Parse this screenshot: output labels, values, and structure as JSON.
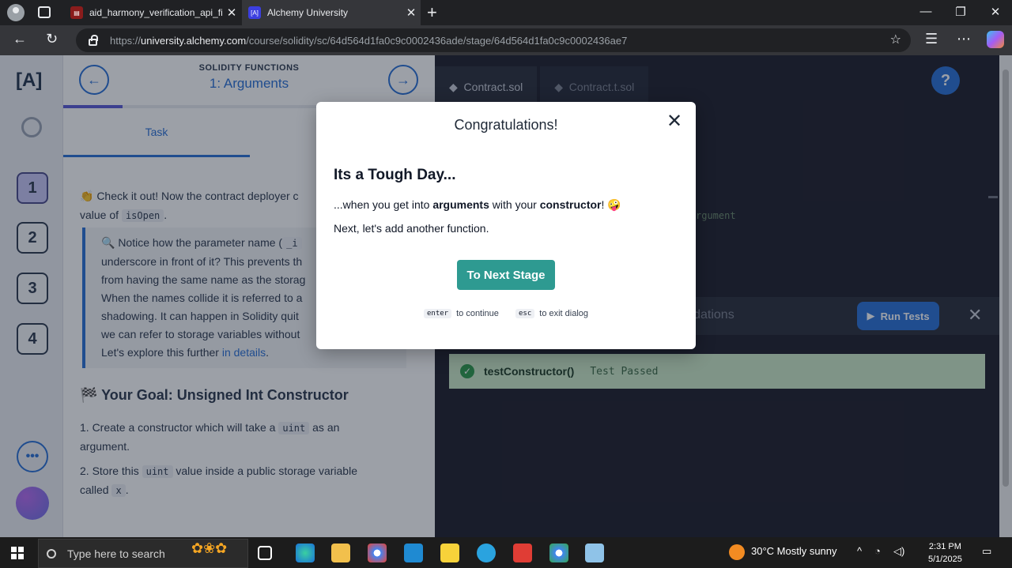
{
  "browser": {
    "tabs": [
      {
        "title": "aid_harmony_verification_api_field",
        "active": false
      },
      {
        "title": "Alchemy University",
        "active": true
      }
    ],
    "url_prefix": "https://",
    "url_host": "university.alchemy.com",
    "url_path": "/course/solidity/sc/64d564d1fa0c9c0002436ade/stage/64d564d1fa0c9c0002436ae7"
  },
  "rail": {
    "logo": "[A]",
    "stages": [
      "1",
      "2",
      "3",
      "4"
    ],
    "more": "•••"
  },
  "lesson": {
    "section": "SOLIDITY FUNCTIONS",
    "stage": "1: Arguments",
    "task_tab": "Task",
    "para1_pre": "👏 Check it out! Now the contract deployer c",
    "para1_line2_pre": "value of ",
    "para1_code": "isOpen",
    "para1_line2_post": ".",
    "note_lines": [
      "🔍 Notice how the parameter name (",
      "underscore in front of it? This prevents th",
      "from having the same name as the storag",
      "When the names collide it is referred to a",
      "shadowing. It can happen in Solidity quit",
      "we can refer to storage variables without",
      "Let's explore this further "
    ],
    "note_code": "_i",
    "note_link": "in details",
    "goal_title": "🏁 Your Goal: Unsigned Int Constructor",
    "goal_items": [
      {
        "pre": "1. Create a constructor which will take a ",
        "code": "uint",
        "post": " as an argument."
      },
      {
        "pre": "2. Store this ",
        "code": "uint",
        "post": " value inside a public storage variable called "
      },
      {
        "code2": "x",
        "post2": "."
      }
    ]
  },
  "editor": {
    "tabs": [
      "Contract.sol",
      "Contract.t.sol"
    ],
    "help": "?",
    "code_snippet": "rgument",
    "results_label": "lidations",
    "run_tests": "Run Tests",
    "test_name": "testConstructor()",
    "test_status": "Test Passed"
  },
  "modal": {
    "title": "Congratulations!",
    "heading": "Its a Tough Day...",
    "body_pre": "...when you get into ",
    "body_bold1": "arguments",
    "body_mid": " with your ",
    "body_bold2": "constructor",
    "body_post": "! 🤪",
    "body_line2": "Next, let's add another function.",
    "next_button": "To Next Stage",
    "hint_enter_key": "enter",
    "hint_enter": "to continue",
    "hint_esc_key": "esc",
    "hint_esc": "to exit dialog"
  },
  "taskbar": {
    "search_placeholder": "Type here to search",
    "weather": "30°C  Mostly sunny",
    "time": "2:31 PM",
    "date": "5/1/2025"
  }
}
